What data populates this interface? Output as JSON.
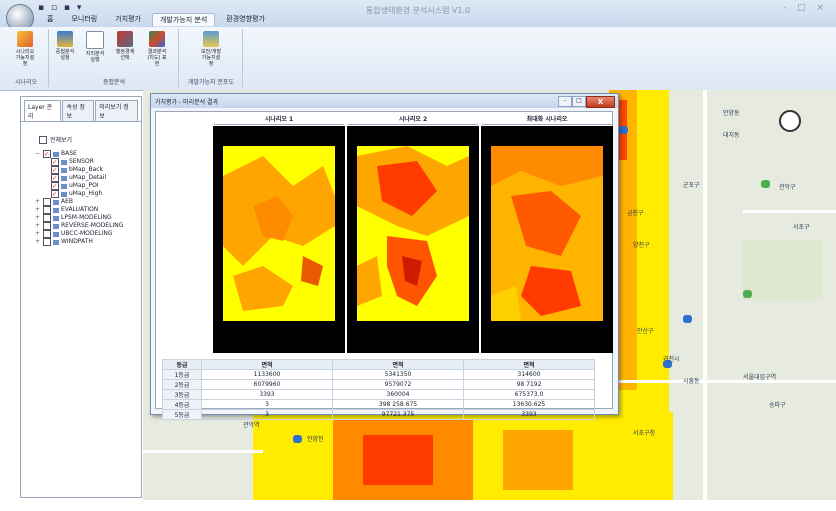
{
  "window": {
    "title": "통합생태환경 분석시스템 V1.0",
    "controls": "‐ □ ×",
    "qat_icons": [
      "save-icon",
      "undo-icon",
      "redo-icon"
    ],
    "qat_text": "▪ ▫ ▪ ▾"
  },
  "ribbon": {
    "tabs": [
      {
        "label": "홈"
      },
      {
        "label": "모니터링"
      },
      {
        "label": "가치평가"
      },
      {
        "label": "개발가능지 분석"
      },
      {
        "label": "환경영향평가"
      }
    ],
    "active_tab": 3,
    "groups": [
      {
        "label": "시나리오",
        "buttons": [
          {
            "label": "시나리오 가능지설정",
            "icon": "scenario-icon"
          }
        ]
      },
      {
        "label": "중첩분석",
        "buttons": [
          {
            "label": "중첩분석 설정",
            "icon": "layers-icon"
          },
          {
            "label": "지리분석 실행",
            "icon": "document-icon"
          },
          {
            "label": "행정경계 선택",
            "icon": "selection-icon"
          },
          {
            "label": "결과분석(지도) 표현",
            "icon": "map-icon"
          }
        ]
      },
      {
        "label": "개발가능지 분포도",
        "buttons": [
          {
            "label": "보전/개발 가능지설정",
            "icon": "chart-icon"
          }
        ]
      }
    ]
  },
  "left_panel": {
    "tabs": [
      {
        "label": "Layer 관리"
      },
      {
        "label": "속성 정보"
      },
      {
        "label": "미리보기 정보"
      }
    ],
    "active_tab": 0,
    "show_all_label": "전체보기",
    "tree": [
      {
        "label": "BASE",
        "level": 0,
        "expander": "−",
        "checked": true
      },
      {
        "label": "SENSOR",
        "level": 1,
        "expander": "",
        "checked": true
      },
      {
        "label": "bMap_Back",
        "level": 1,
        "expander": "",
        "checked": true
      },
      {
        "label": "uMap_Detail",
        "level": 1,
        "expander": "",
        "checked": true
      },
      {
        "label": "uMap_POI",
        "level": 1,
        "expander": "",
        "checked": true
      },
      {
        "label": "uMap_High",
        "level": 1,
        "expander": "",
        "checked": true
      },
      {
        "label": "AEB",
        "level": 0,
        "expander": "+",
        "checked": false
      },
      {
        "label": "EVALUATION",
        "level": 0,
        "expander": "+",
        "checked": false
      },
      {
        "label": "LPSM-MODELING",
        "level": 0,
        "expander": "+",
        "checked": false
      },
      {
        "label": "REVERSE-MODELING",
        "level": 0,
        "expander": "+",
        "checked": false
      },
      {
        "label": "UBCC-MODELING",
        "level": 0,
        "expander": "+",
        "checked": false
      },
      {
        "label": "WINDPATH",
        "level": 0,
        "expander": "+",
        "checked": false
      }
    ]
  },
  "dialog": {
    "title": "가치평가 - 미리분석 결과",
    "close_label": "X",
    "min_label": "‐",
    "max_label": "□",
    "scenarios": [
      {
        "label": "시나리오 1"
      },
      {
        "label": "시나리오 2"
      },
      {
        "label": "최대화 시나리오"
      }
    ],
    "table": {
      "headers": [
        "등급",
        "면적",
        "면적",
        "면적"
      ],
      "rows": [
        {
          "grade": "1등급",
          "values": [
            "1133600",
            "5341350",
            "314600"
          ]
        },
        {
          "grade": "2등급",
          "values": [
            "6079960",
            "9579072",
            "98 7192"
          ]
        },
        {
          "grade": "3등급",
          "values": [
            "3393",
            "360004",
            "675373.0"
          ]
        },
        {
          "grade": "4등급",
          "values": [
            "3",
            "398 258.675",
            "13630.625"
          ]
        },
        {
          "grade": "5등급",
          "values": [
            "3",
            "97721.375",
            "3393"
          ]
        }
      ]
    }
  },
  "map": {
    "labels": [
      {
        "text": "안양동"
      },
      {
        "text": "대치동"
      },
      {
        "text": "군포구"
      },
      {
        "text": "금천구"
      },
      {
        "text": "관악구"
      },
      {
        "text": "서초구"
      },
      {
        "text": "양천구"
      },
      {
        "text": "안산구"
      },
      {
        "text": "과천시"
      },
      {
        "text": "시흥동"
      },
      {
        "text": "송파구"
      },
      {
        "text": "관악역"
      },
      {
        "text": "안양천"
      },
      {
        "text": "서울대입구역"
      },
      {
        "text": "서초구청"
      }
    ]
  },
  "colors": {
    "yellow": "#ffff00",
    "orange": "#ffa500",
    "red": "#ff2200",
    "ribbon_blue": "#dde8f5",
    "map_bg": "#e7eadf"
  }
}
